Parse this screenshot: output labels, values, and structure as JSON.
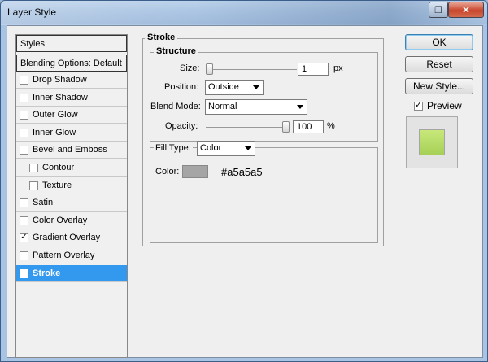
{
  "window": {
    "title": "Layer Style"
  },
  "styles_list": {
    "header": "Styles",
    "blending": "Blending Options: Default",
    "items": [
      {
        "label": "Drop Shadow",
        "checked": false,
        "indent": false,
        "selected": false
      },
      {
        "label": "Inner Shadow",
        "checked": false,
        "indent": false,
        "selected": false
      },
      {
        "label": "Outer Glow",
        "checked": false,
        "indent": false,
        "selected": false
      },
      {
        "label": "Inner Glow",
        "checked": false,
        "indent": false,
        "selected": false
      },
      {
        "label": "Bevel and Emboss",
        "checked": false,
        "indent": false,
        "selected": false
      },
      {
        "label": "Contour",
        "checked": false,
        "indent": true,
        "selected": false
      },
      {
        "label": "Texture",
        "checked": false,
        "indent": true,
        "selected": false
      },
      {
        "label": "Satin",
        "checked": false,
        "indent": false,
        "selected": false
      },
      {
        "label": "Color Overlay",
        "checked": false,
        "indent": false,
        "selected": false
      },
      {
        "label": "Gradient Overlay",
        "checked": true,
        "indent": false,
        "selected": false
      },
      {
        "label": "Pattern Overlay",
        "checked": false,
        "indent": false,
        "selected": false
      },
      {
        "label": "Stroke",
        "checked": true,
        "indent": false,
        "selected": true
      }
    ]
  },
  "stroke": {
    "section_title": "Stroke",
    "structure_title": "Structure",
    "size_label": "Size:",
    "size_value": "1",
    "size_unit": "px",
    "position_label": "Position:",
    "position_value": "Outside",
    "blend_label": "Blend Mode:",
    "blend_value": "Normal",
    "opacity_label": "Opacity:",
    "opacity_value": "100",
    "opacity_unit": "%",
    "fill_type_label": "Fill Type:",
    "fill_type_value": "Color",
    "color_label": "Color:",
    "color_hex": "#a5a5a5"
  },
  "buttons": {
    "ok": "OK",
    "reset": "Reset",
    "new_style": "New Style...",
    "preview_label": "Preview",
    "preview_checked": true
  },
  "colors": {
    "swatch": "#a5a5a5",
    "selected_row": "#3399ee",
    "preview_fill": "#b8dc6a"
  }
}
